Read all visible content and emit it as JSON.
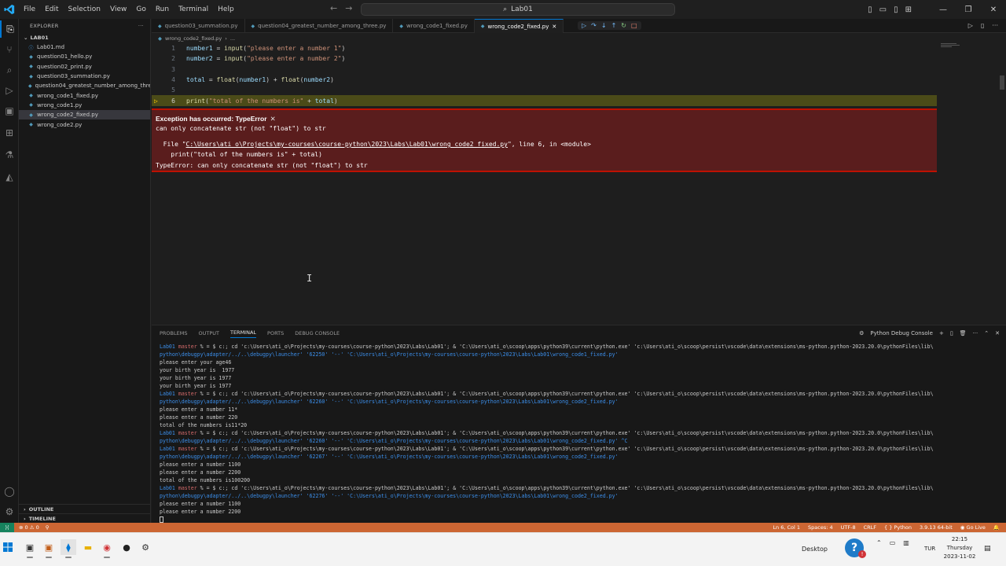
{
  "titlebar": {
    "menu": [
      "File",
      "Edit",
      "Selection",
      "View",
      "Go",
      "Run",
      "Terminal",
      "Help"
    ],
    "search_text": "Lab01"
  },
  "sidebar": {
    "header": "EXPLORER",
    "folder": "LAB01",
    "files": [
      "Lab01.md",
      "question01_hello.py",
      "question02_print.py",
      "question03_summation.py",
      "question04_greatest_number_among_three.py",
      "wrong_code1_fixed.py",
      "wrong_code1.py",
      "wrong_code2_fixed.py",
      "wrong_code2.py"
    ],
    "outline": "OUTLINE",
    "timeline": "TIMELINE"
  },
  "tabs": [
    "question03_summation.py",
    "question04_greatest_number_among_three.py",
    "wrong_code1_fixed.py",
    "wrong_code2_fixed.py"
  ],
  "breadcrumb": {
    "file": "wrong_code2_fixed.py",
    "more": "..."
  },
  "code": {
    "line_numbers": [
      "1",
      "2",
      "3",
      "4",
      "5",
      "6"
    ],
    "l1": {
      "var": "number1",
      "op": " = ",
      "fn": "input",
      "str": "\"please enter a number 1\""
    },
    "l2": {
      "var": "number2",
      "op": " = ",
      "fn": "input",
      "str": "\"please enter a number 2\""
    },
    "l4": {
      "var": "total",
      "op": " = ",
      "fn": "float",
      "arg1": "number1",
      "plus": " + ",
      "fn2": "float",
      "arg2": "number2"
    },
    "l6": {
      "fn": "print",
      "str": "\"total of the numbers is\"",
      "plus": " + ",
      "var": "total"
    }
  },
  "exception": {
    "title": "Exception has occurred: TypeError",
    "message": "can only concatenate str (not \"float\") to str",
    "file_prefix": "  File \"",
    "file_path": "C:\\Users\\ati_o\\Projects\\my-courses\\course-python\\2023\\Labs\\Lab01\\wrong_code2_fixed.py",
    "file_suffix": "\", line 6, in <module>",
    "code_line": "    print(\"total of the numbers is\" + total)",
    "error_line": "TypeError: can only concatenate str (not \"float\") to str"
  },
  "panel": {
    "tabs": [
      "PROBLEMS",
      "OUTPUT",
      "TERMINAL",
      "PORTS",
      "DEBUG CONSOLE"
    ],
    "active_tab": "TERMINAL",
    "console_name": "Python Debug Console"
  },
  "terminal": {
    "prompt_dir": "Lab01",
    "prompt_branch": "master",
    "prompt_rest": " % = $ ",
    "cmd_start": "c:; cd 'c:\\Users\\ati_o\\Projects\\my-courses\\course-python\\2023\\Labs\\Lab01'; & 'C:\\Users\\ati_o\\scoop\\apps\\python39\\current\\python.exe' 'c:\\Users\\ati_o\\scoop\\persist\\vscode\\data\\extensions\\ms-python.python-2023.20.0\\pythonFiles\\lib\\",
    "runs": [
      {
        "cont": "python\\debugpy\\adapter/../..\\debugpy\\launcher' '62250' '--' 'C:\\Users\\ati_o\\Projects\\my-courses\\course-python\\2023\\Labs\\Lab01\\wrong_code1_fixed.py'",
        "output": [
          "please enter your age46",
          "your birth year is  1977",
          "your birth year is 1977",
          "your birth year is 1977"
        ]
      },
      {
        "cont": "python\\debugpy\\adapter/../..\\debugpy\\launcher' '62260' '--' 'C:\\Users\\ati_o\\Projects\\my-courses\\course-python\\2023\\Labs\\Lab01\\wrong_code2_fixed.py'",
        "output": [
          "please enter a number 11*",
          "please enter a number 220",
          "total of the numbers is11*20"
        ]
      },
      {
        "cont": "python\\debugpy\\adapter/../..\\debugpy\\launcher' '62260' '--' 'C:\\Users\\ati_o\\Projects\\my-courses\\course-python\\2023\\Labs\\Lab01\\wrong_code2_fixed.py' ^C",
        "output": []
      },
      {
        "cont": "python\\debugpy\\adapter/../..\\debugpy\\launcher' '62267' '--' 'C:\\Users\\ati_o\\Projects\\my-courses\\course-python\\2023\\Labs\\Lab01\\wrong_code2_fixed.py'",
        "output": [
          "please enter a number 1100",
          "please enter a number 2200",
          "total of the numbers is100200"
        ]
      },
      {
        "cont": "python\\debugpy\\adapter/../..\\debugpy\\launcher' '62276' '--' 'C:\\Users\\ati_o\\Projects\\my-courses\\course-python\\2023\\Labs\\Lab01\\wrong_code2_fixed.py'",
        "output": [
          "please enter a number 1100",
          "please enter a number 2200"
        ]
      }
    ]
  },
  "statusbar": {
    "errors": "0",
    "warnings": "0",
    "position": "Ln 6, Col 1",
    "spaces": "Spaces: 4",
    "encoding": "UTF-8",
    "eol": "CRLF",
    "language": "Python",
    "interpreter": "3.9.13 64-bit",
    "golive": "Go Live"
  },
  "taskbar": {
    "desktop": "Desktop",
    "lang": "TUR",
    "time": "22:15",
    "day": "Thursday",
    "date": "2023-11-02"
  },
  "colors": {
    "accent": "#0078d4",
    "statusbar": "#cc6633",
    "exception_bg": "#5a1d1d",
    "exception_border": "#be1100"
  }
}
